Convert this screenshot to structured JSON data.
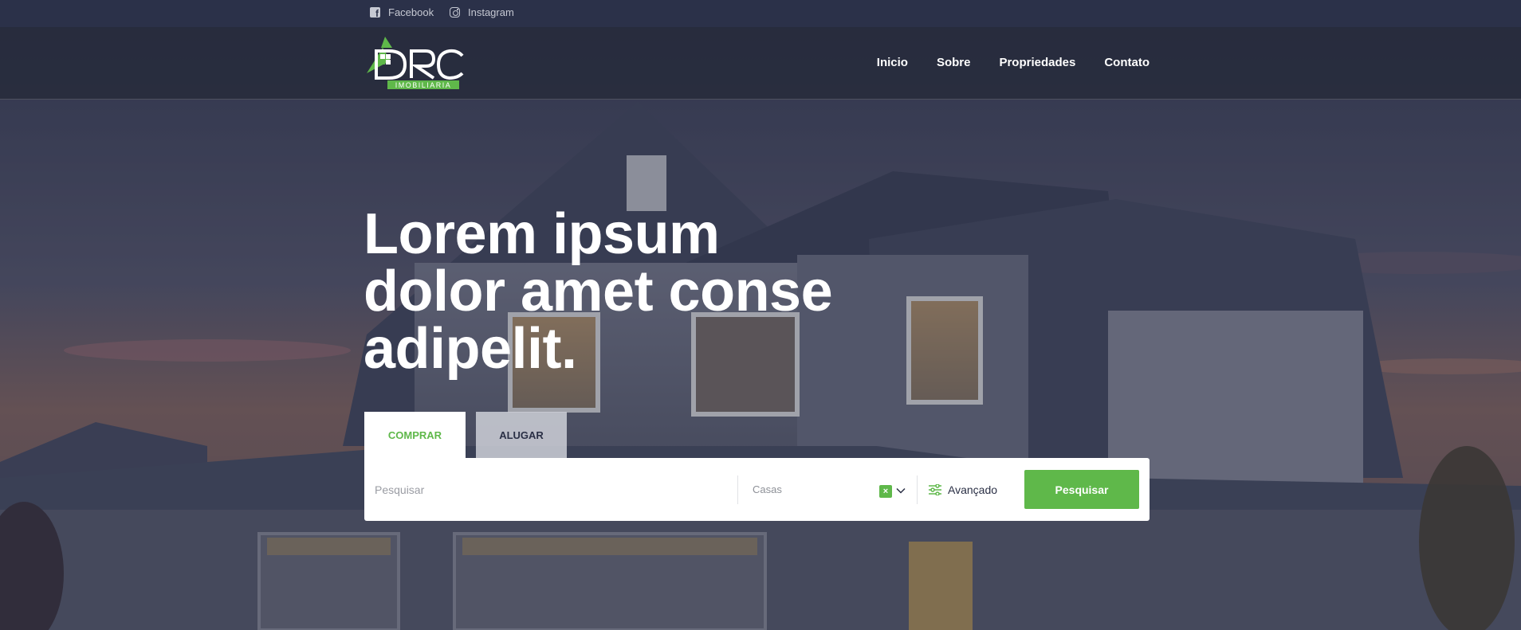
{
  "topbar": {
    "social": [
      {
        "label": "Facebook",
        "icon": "facebook-icon"
      },
      {
        "label": "Instagram",
        "icon": "instagram-icon"
      }
    ]
  },
  "header": {
    "logo_text": "DRC",
    "logo_subtext": "IMOBILIARIA",
    "nav": [
      "Inicio",
      "Sobre",
      "Propriedades",
      "Contato"
    ]
  },
  "hero": {
    "title_lines": [
      "Lorem ipsum",
      "dolor amet conse",
      "adipelit."
    ]
  },
  "search": {
    "tabs": [
      "COMPRAR",
      "ALUGAR"
    ],
    "active_tab": "COMPRAR",
    "placeholder": "Pesquisar",
    "type_value": "Casas",
    "advanced_label": "Avançado",
    "submit_label": "Pesquisar"
  },
  "colors": {
    "accent": "#5fb84a",
    "topbar": "#2b3149",
    "text_dark": "#2a2f45"
  }
}
